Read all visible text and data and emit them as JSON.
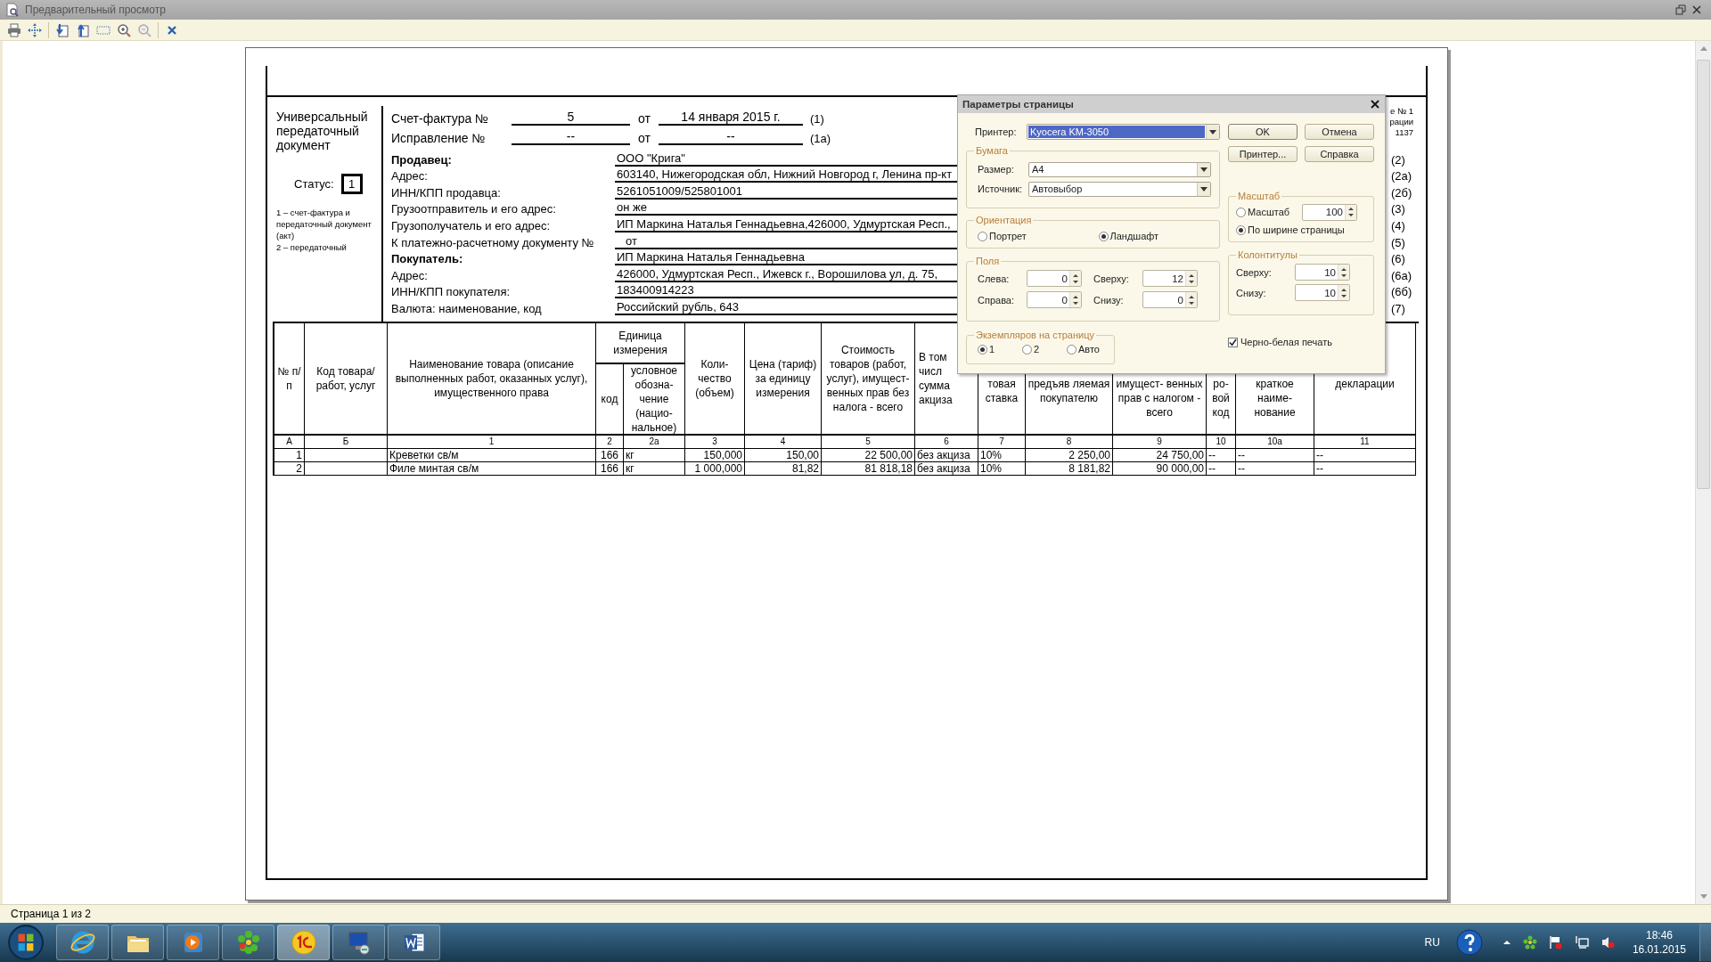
{
  "window": {
    "title": "Предварительный просмотр"
  },
  "document": {
    "left": {
      "title": "Универсальный передаточный документ",
      "status_label": "Статус:",
      "status": "1",
      "notes": [
        "1 – счет-фактура и передаточный документ (акт)",
        "2 – передаточный"
      ]
    },
    "invoice": [
      {
        "label": "Счет-фактура №",
        "number": "5",
        "from": "от",
        "date": "14 января 2015 г.",
        "code": "(1)"
      },
      {
        "label": "Исправление №",
        "number": "--",
        "from": "от",
        "date": "--",
        "code": "(1а)"
      }
    ],
    "corner_note": [
      "е № 1",
      "рации",
      "1137"
    ],
    "fields": [
      {
        "label": "Продавец:",
        "bold": true,
        "value": "ООО \"Крига\"",
        "code": "(2)"
      },
      {
        "label": "Адрес:",
        "bold": false,
        "value": "603140, Нижегородская обл, Нижний Новгород г, Ленина пр-кт",
        "code": "(2а)"
      },
      {
        "label": "ИНН/КПП продавца:",
        "bold": false,
        "value": "5261051009/525801001",
        "code": "(2б)"
      },
      {
        "label": "Грузоотправитель и его адрес:",
        "bold": false,
        "value": "он же",
        "code": "(3)"
      },
      {
        "label": "Грузополучатель и его адрес:",
        "bold": false,
        "value": "ИП Маркина Наталья Геннадьевна,426000, Удмуртская Респ.,",
        "code": "(4)"
      },
      {
        "label": "К платежно-расчетному документу №",
        "bold": false,
        "value": "от",
        "code": "(5)"
      },
      {
        "label": "Покупатель:",
        "bold": true,
        "value": "ИП Маркина Наталья Геннадьевна",
        "code": "(6)"
      },
      {
        "label": "Адрес:",
        "bold": false,
        "value": "426000, Удмуртская Респ., Ижевск г., Ворошилова ул, д. 75,",
        "code": "(6а)"
      },
      {
        "label": "ИНН/КПП покупателя:",
        "bold": false,
        "value": "183400914223",
        "code": "(6б)"
      },
      {
        "label": "Валюта: наименование, код",
        "bold": false,
        "value": "Российский рубль, 643",
        "code": "(7)"
      }
    ],
    "table": {
      "group": "Единица измерения",
      "columns": [
        {
          "header": "№ п/п",
          "number": "А",
          "kind": "main"
        },
        {
          "header": "Код товара/ работ, услуг",
          "number": "Б",
          "kind": "main"
        },
        {
          "header": "Наименование товара (описание выполненных работ, оказанных услуг), имущественного права",
          "number": "1",
          "kind": "main"
        },
        {
          "header": "код",
          "number": "2",
          "kind": "sub"
        },
        {
          "header": "условное обозна- чение (нацио- нальное)",
          "number": "2а",
          "kind": "sub"
        },
        {
          "header": "Коли- чество (объем)",
          "number": "3",
          "kind": "main"
        },
        {
          "header": "Цена (тариф) за единицу измерения",
          "number": "4",
          "kind": "main"
        },
        {
          "header": "Стоимость товаров (работ, услуг), имущест- венных прав без налога - всего",
          "number": "5",
          "kind": "main"
        },
        {
          "header": "В том числ сумма акциза",
          "number": "6",
          "kind": "main"
        },
        {
          "header": "товая ставка",
          "number": "7",
          "kind": "main"
        },
        {
          "header": "предъяв ляемая покупателю",
          "number": "8",
          "kind": "main"
        },
        {
          "header": "имущест- венных прав с налогом - всего",
          "number": "9",
          "kind": "main"
        },
        {
          "header": "ро- вой код",
          "number": "10",
          "kind": "main"
        },
        {
          "header": "краткое наиме- нование",
          "number": "10а",
          "kind": "main"
        },
        {
          "header": "декларации",
          "number": "11",
          "kind": "main"
        }
      ],
      "rows": [
        [
          "1",
          "",
          "Креветки св/м",
          "166",
          "кг",
          "150,000",
          "150,00",
          "22 500,00",
          "без акциза",
          "10%",
          "2 250,00",
          "24 750,00",
          "--",
          "--",
          "--"
        ],
        [
          "2",
          "",
          "Филе минтая св/м",
          "166",
          "кг",
          "1 000,000",
          "81,82",
          "81 818,18",
          "без акциза",
          "10%",
          "8 181,82",
          "90 000,00",
          "--",
          "--",
          "--"
        ]
      ]
    }
  },
  "dialog": {
    "title": "Параметры страницы",
    "printer_label": "Принтер:",
    "printer": "Kyocera KM-3050",
    "buttons": [
      {
        "label": "OK",
        "default": true
      },
      {
        "label": "Отмена",
        "default": false
      },
      {
        "label": "Принтер...",
        "default": false
      },
      {
        "label": "Справка",
        "default": false
      }
    ],
    "paper": {
      "title": "Бумага",
      "size_label": "Размер:",
      "size": "А4",
      "source_label": "Источник:",
      "source": "Автовыбор"
    },
    "orientation": {
      "title": "Ориентация",
      "options": [
        {
          "label": "Портрет",
          "selected": false
        },
        {
          "label": "Ландшафт",
          "selected": true
        }
      ]
    },
    "scale": {
      "title": "Масштаб",
      "options": [
        {
          "label": "Масштаб",
          "selected": false,
          "value": "100"
        },
        {
          "label": "По ширине страницы",
          "selected": true
        }
      ]
    },
    "margins": {
      "title": "Поля",
      "fields": [
        {
          "label": "Слева:",
          "value": "0"
        },
        {
          "label": "Сверху:",
          "value": "12"
        },
        {
          "label": "Справа:",
          "value": "0"
        },
        {
          "label": "Снизу:",
          "value": "0"
        }
      ]
    },
    "headers": {
      "title": "Колонтитулы",
      "fields": [
        {
          "label": "Сверху:",
          "value": "10"
        },
        {
          "label": "Снизу:",
          "value": "10"
        }
      ]
    },
    "copies": {
      "title": "Экземпляров на страницу",
      "options": [
        {
          "label": "1",
          "selected": true
        },
        {
          "label": "2",
          "selected": false
        },
        {
          "label": "Авто",
          "selected": false
        }
      ]
    },
    "bw": {
      "label": "Черно-белая печать",
      "checked": true
    }
  },
  "status_bar": "Страница 1 из 2",
  "tray": {
    "language": "RU",
    "time": "18:46",
    "date": "16.01.2015"
  }
}
